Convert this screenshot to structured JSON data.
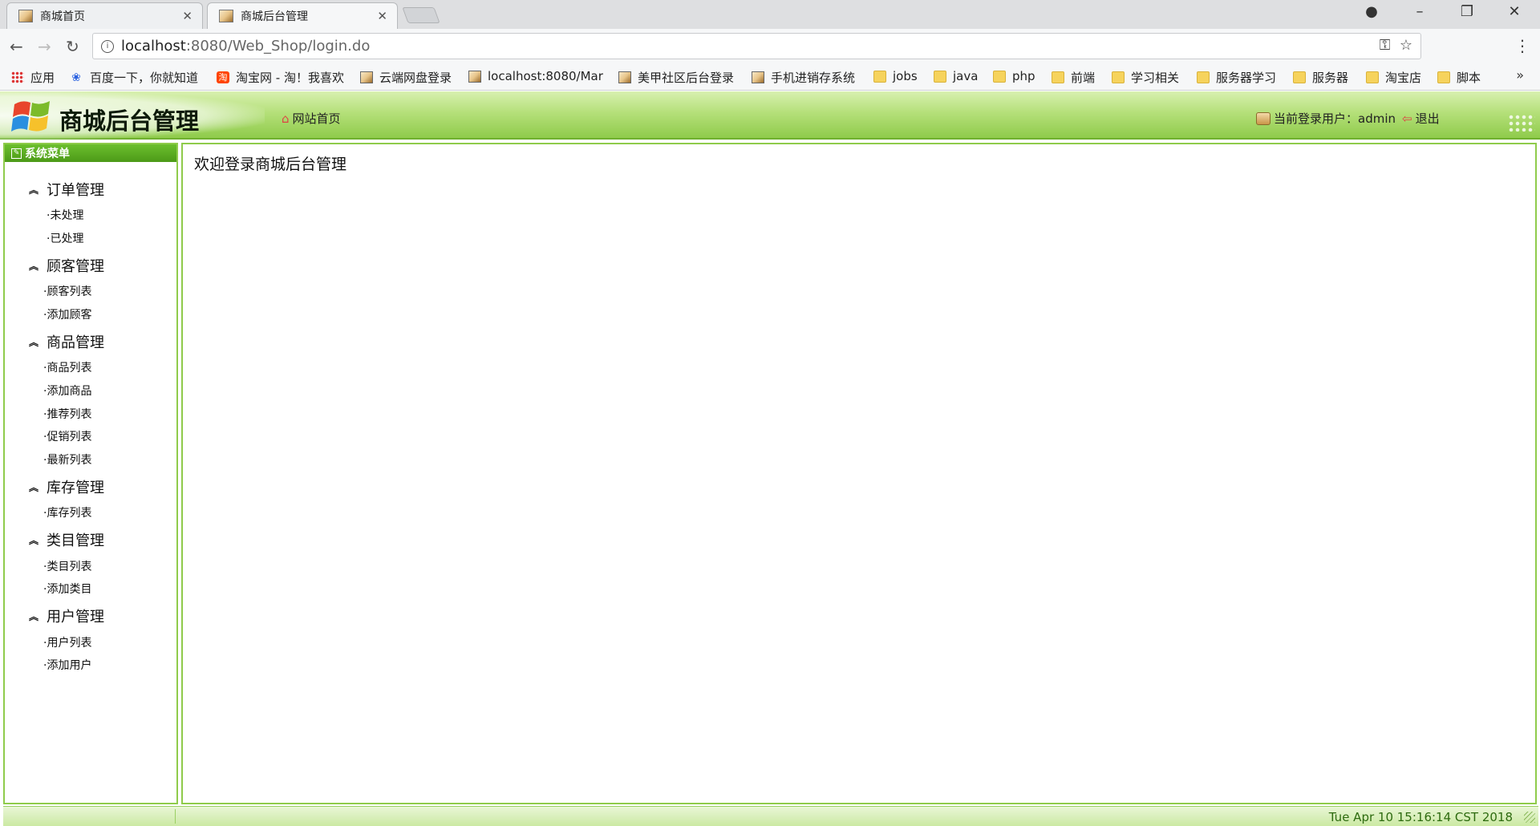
{
  "browser": {
    "tabs": [
      {
        "label": "商城首页",
        "active": false
      },
      {
        "label": "商城后台管理",
        "active": true
      }
    ],
    "url_host": "localhost",
    "url_path": ":8080/Web_Shop/login.do",
    "bookmarks": [
      {
        "label": "应用",
        "icon": "apps-grid-icon"
      },
      {
        "label": "百度一下，你就知道",
        "icon": "baidu-paw-icon"
      },
      {
        "label": "淘宝网 - 淘！我喜欢",
        "icon": "taobao-icon"
      },
      {
        "label": "云端网盘登录",
        "icon": "page-icon"
      },
      {
        "label": "localhost:8080/Mar",
        "icon": "page-icon"
      },
      {
        "label": "美甲社区后台登录",
        "icon": "page-icon"
      },
      {
        "label": "手机进销存系统",
        "icon": "page-icon"
      },
      {
        "label": "jobs",
        "icon": "folder-icon"
      },
      {
        "label": "java",
        "icon": "folder-icon"
      },
      {
        "label": "php",
        "icon": "folder-icon"
      },
      {
        "label": "前端",
        "icon": "folder-icon"
      },
      {
        "label": "学习相关",
        "icon": "folder-icon"
      },
      {
        "label": "服务器学习",
        "icon": "folder-icon"
      },
      {
        "label": "服务器",
        "icon": "folder-icon"
      },
      {
        "label": "淘宝店",
        "icon": "folder-icon"
      },
      {
        "label": "脚本",
        "icon": "folder-icon"
      }
    ],
    "more_glyph": "»"
  },
  "header": {
    "title": "商城后台管理",
    "home_link": "网站首页",
    "user_label": "当前登录用户：",
    "username": "admin",
    "logout": "退出"
  },
  "sidebar": {
    "heading": "系统菜单",
    "groups": [
      {
        "title": "订单管理",
        "items": [
          "·未处理",
          "·已处理"
        ]
      },
      {
        "title": "顾客管理",
        "items": [
          "·顾客列表",
          "·添加顾客"
        ]
      },
      {
        "title": "商品管理",
        "items": [
          "·商品列表",
          "·添加商品",
          "·推荐列表",
          "·促销列表",
          "·最新列表"
        ]
      },
      {
        "title": "库存管理",
        "items": [
          "·库存列表"
        ]
      },
      {
        "title": "类目管理",
        "items": [
          "·类目列表",
          "·添加类目"
        ]
      },
      {
        "title": "用户管理",
        "items": [
          "·用户列表",
          "·添加用户"
        ]
      }
    ]
  },
  "main": {
    "welcome": "欢迎登录商城后台管理"
  },
  "status": {
    "clock": "Tue Apr 10 15:16:14 CST 2018"
  },
  "colors": {
    "header_green": "#8fcb4b",
    "sidebar_head": "#4c9a18",
    "clock_text": "#2e6b10"
  }
}
